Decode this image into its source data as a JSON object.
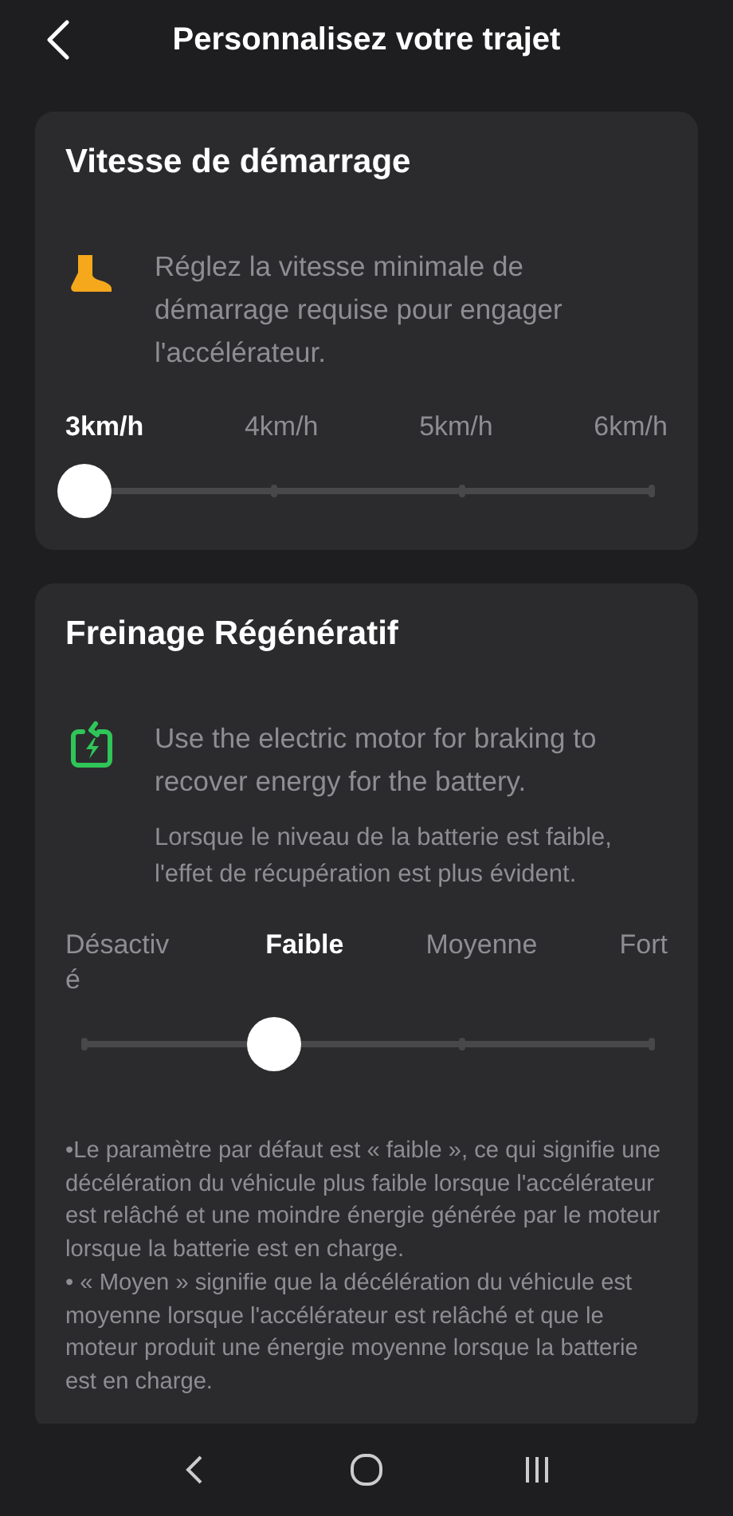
{
  "header": {
    "title": "Personnalisez votre trajet"
  },
  "sections": [
    {
      "kind": "speed",
      "title": "Vitesse de démarrage",
      "descriptions": [
        "Réglez la vitesse minimale de démarrage requise pour engager l'accélérateur."
      ],
      "options": [
        {
          "label": "3km/h",
          "selected": true
        },
        {
          "label": "4km/h",
          "selected": false
        },
        {
          "label": "5km/h",
          "selected": false
        },
        {
          "label": "6km/h",
          "selected": false
        }
      ],
      "level": 0
    },
    {
      "kind": "regen",
      "title": "Freinage Régénératif",
      "descriptions": [
        "Use the electric motor for braking to recover energy for the battery.",
        "Lorsque le niveau de la batterie est faible, l'effet de récupération est plus évident."
      ],
      "options": [
        {
          "label": "Désactivé",
          "selected": false
        },
        {
          "label": "Faible",
          "selected": true
        },
        {
          "label": "Moyenne",
          "selected": false
        },
        {
          "label": "Fort",
          "selected": false
        }
      ],
      "level": 0.3333,
      "notes": [
        "•Le paramètre par défaut est « faible », ce qui signifie une décélération du véhicule plus faible lorsque l'accélérateur est relâché et une moindre énergie générée par le moteur lorsque la batterie est en charge.",
        "• « Moyen » signifie que la décélération du véhicule est moyenne lorsque l'accélérateur est relâché et que le moteur produit une énergie moyenne lorsque la batterie est en charge."
      ]
    }
  ]
}
